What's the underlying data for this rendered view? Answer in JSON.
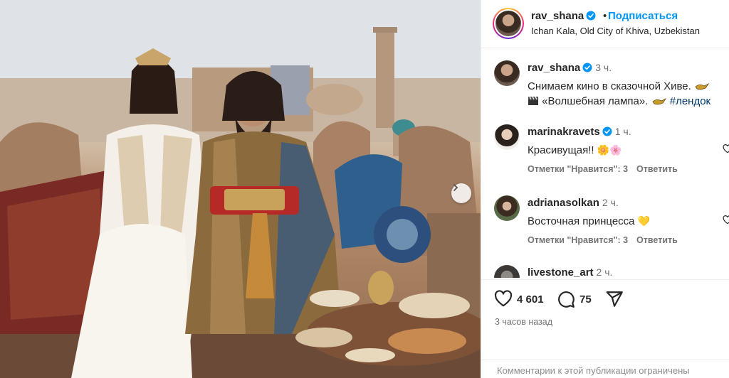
{
  "post": {
    "username": "rav_shana",
    "follow_label": "Подписаться",
    "separator": "•",
    "location": "Ichan Kala, Old City of Khiva, Uzbekistan"
  },
  "caption": {
    "username": "rav_shana",
    "time": "3 ч.",
    "line1": "Снимаем кино в сказочной Хиве.",
    "line2_prefix": "«Волшебная лампа».",
    "hashtag": "#лендок"
  },
  "comments": [
    {
      "username": "marinakravets",
      "time": "1 ч.",
      "text": "Красивущая!!",
      "emoji": "🌼🌸",
      "likes_label": "Отметки \"Нравится\": 3",
      "reply_label": "Ответить"
    },
    {
      "username": "adrianasolkan",
      "time": "2 ч.",
      "text": "Восточная принцесса",
      "emoji": "💛",
      "likes_label": "Отметки \"Нравится\": 3",
      "reply_label": "Ответить"
    },
    {
      "username": "livestone_art",
      "time": "2 ч."
    }
  ],
  "stats": {
    "likes": "4 601",
    "comments": "75"
  },
  "posted_ago": "3 часов назад",
  "footer_text": "Комментарии к этой публикации ограничены",
  "colors": {
    "link": "#0095f6",
    "muted": "#737373",
    "verified": "#0095f6"
  }
}
